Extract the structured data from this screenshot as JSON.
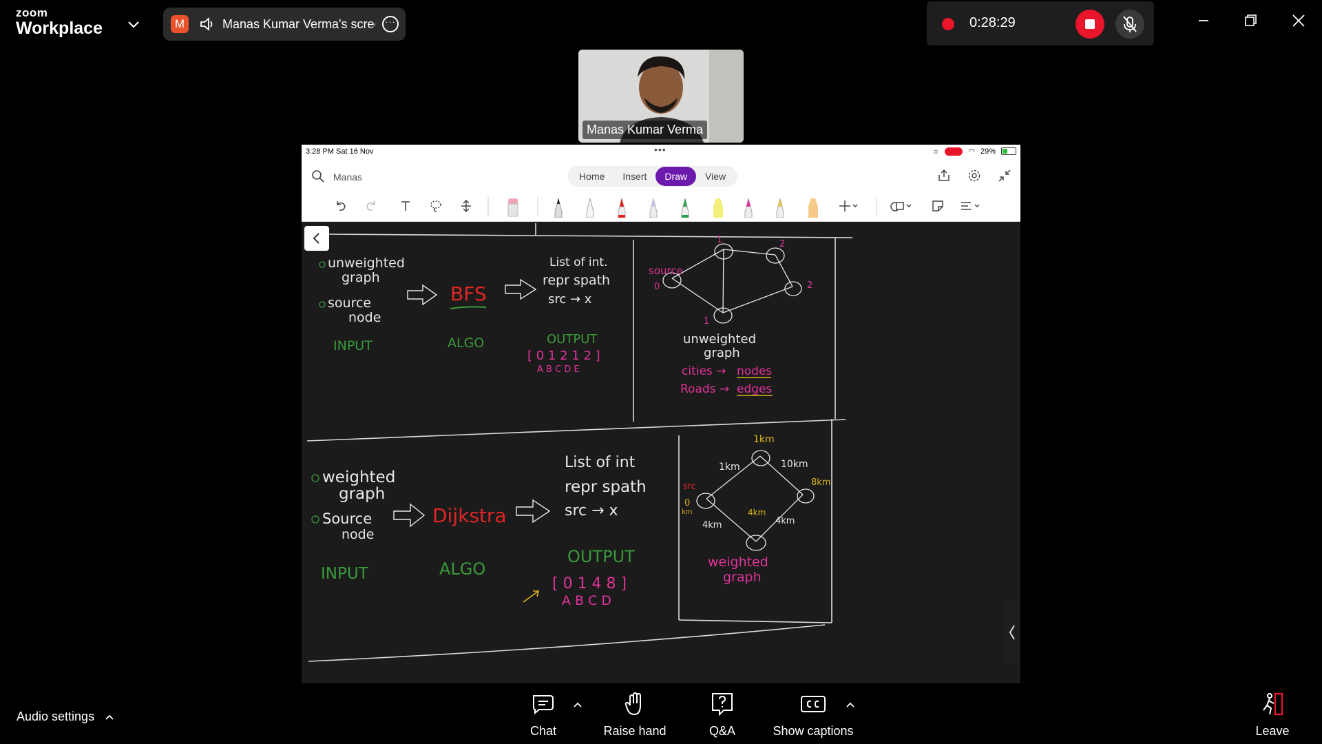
{
  "app": {
    "brand_top": "zoom",
    "brand_bottom": "Workplace"
  },
  "share": {
    "initial": "M",
    "title": "Manas Kumar Verma's scree"
  },
  "recording": {
    "time": "0:28:29"
  },
  "video": {
    "participant_name": "Manas Kumar Verma"
  },
  "ipad": {
    "status_time": "3:28 PM  Sat 16 Nov",
    "battery": "29%",
    "search_text": "Manas",
    "tabs": [
      "Home",
      "Insert",
      "Draw",
      "View"
    ],
    "active_tab": "Draw"
  },
  "notes": {
    "top": {
      "input1": "unweighted",
      "input1b": "graph",
      "input2": "source",
      "input2b": "node",
      "input_label": "INPUT",
      "algo": "BFS",
      "algo_label": "ALGO",
      "out1": "List of int.",
      "out2": "repr spath",
      "out3": "src → x",
      "output_label": "OUTPUT",
      "output_values": "[ 0  1  2  1  2 ]",
      "output_nodes": "A  B  C  D  E",
      "graph_source": "source",
      "graph_labels": [
        "1",
        "2",
        "0",
        "2",
        "1"
      ],
      "graph_caption1": "unweighted",
      "graph_caption2": "graph",
      "map1_a": "cities →",
      "map1_b": "nodes",
      "map2_a": "Roads →",
      "map2_b": "edges"
    },
    "bottom": {
      "input1": "weighted",
      "input1b": "graph",
      "input2": "Source",
      "input2b": "node",
      "input_label": "INPUT",
      "algo": "Dijkstra",
      "algo_label": "ALGO",
      "out1": "List of int",
      "out2": "repr spath",
      "out3": "src → x",
      "output_label": "OUTPUT",
      "output_values": "[ 0  1  4  8 ]",
      "output_nodes": "A  B  C  D",
      "graph_src": "src",
      "w_top": "1km",
      "w_ab": "1km",
      "w_bd": "10km",
      "w_d": "8km",
      "w_a": "0",
      "w_akm": "km",
      "w_ac": "4km",
      "w_cd": "4km",
      "w_c": "4km",
      "graph_caption1": "weighted",
      "graph_caption2": "graph"
    }
  },
  "bottombar": {
    "audio_settings": "Audio settings",
    "chat": "Chat",
    "raise_hand": "Raise hand",
    "qa": "Q&A",
    "show_captions": "Show captions",
    "leave": "Leave"
  },
  "colors": {
    "record_red": "#e8152b",
    "draw_purple": "#6c1aad",
    "ink_pink": "#e0339a",
    "ink_red": "#e02424",
    "ink_green": "#3a9a3a",
    "ink_yellow": "#d9b21a"
  }
}
